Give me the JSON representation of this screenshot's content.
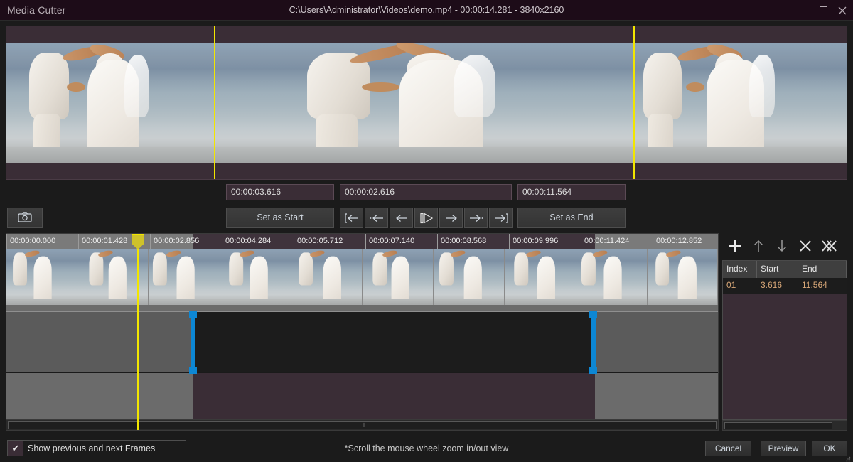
{
  "window": {
    "app_title": "Media Cutter",
    "center_title": "C:\\Users\\Administrator\\Videos\\demo.mp4 - 00:00:14.281 - 3840x2160",
    "maximize_icon": "maximize-icon",
    "close_icon": "close-icon"
  },
  "preview": {
    "previous_label": "previous-frame-pane",
    "current_label": "current-frame-pane",
    "next_label": "next-frame-pane"
  },
  "fields": {
    "start_value": "00:00:03.616",
    "current_value": "00:00:02.616",
    "end_value": "00:00:11.564"
  },
  "controls": {
    "snapshot_icon": "camera-icon",
    "set_as_start": "Set as Start",
    "set_as_end": "Set as End",
    "nav": [
      {
        "name": "jump-to-start-button",
        "glyph": "[←"
      },
      {
        "name": "step-back-fast-button",
        "glyph": "··←"
      },
      {
        "name": "step-back-button",
        "glyph": "←"
      },
      {
        "name": "play-pause-button",
        "glyph": "▐▷"
      },
      {
        "name": "step-forward-button",
        "glyph": "→"
      },
      {
        "name": "step-forward-fast-button",
        "glyph": "→··"
      },
      {
        "name": "jump-to-end-button",
        "glyph": "→]"
      }
    ]
  },
  "timeline": {
    "ticks": [
      "00:00:00.000",
      "00:00:01.428",
      "00:00:02.856",
      "00:00:04.284",
      "00:00:05.712",
      "00:00:07.140",
      "00:00:08.568",
      "00:00:09.996",
      "00:00:11.424",
      "00:00:12.852"
    ],
    "playhead_time": "00:00:02.616",
    "selection_start": "00:00:03.616",
    "selection_end": "00:00:11.564",
    "scroll_grip": "⦀"
  },
  "segments": {
    "tools": [
      {
        "name": "add-segment-button",
        "glyph": "+"
      },
      {
        "name": "move-up-button",
        "glyph": "↑"
      },
      {
        "name": "move-down-button",
        "glyph": "↓"
      },
      {
        "name": "delete-segment-button",
        "glyph": "✕"
      },
      {
        "name": "delete-all-segments-button",
        "glyph": "✖"
      }
    ],
    "columns": [
      "Index",
      "Start",
      "End"
    ],
    "rows": [
      {
        "index": "01",
        "start": "3.616",
        "end": "11.564"
      }
    ],
    "scroll_grip": "⦀"
  },
  "footer": {
    "checkbox_checked": true,
    "checkbox_mark": "✔",
    "checkbox_label": "Show previous and next Frames",
    "hint": "*Scroll the mouse wheel zoom in/out view",
    "cancel": "Cancel",
    "preview": "Preview",
    "ok": "OK"
  },
  "colors": {
    "accent_yellow": "#f2e600",
    "handle_blue": "#0d87d4",
    "title_bg": "#1d0c18",
    "panel_bg": "#3a2d36",
    "row_text": "#d9a878"
  }
}
